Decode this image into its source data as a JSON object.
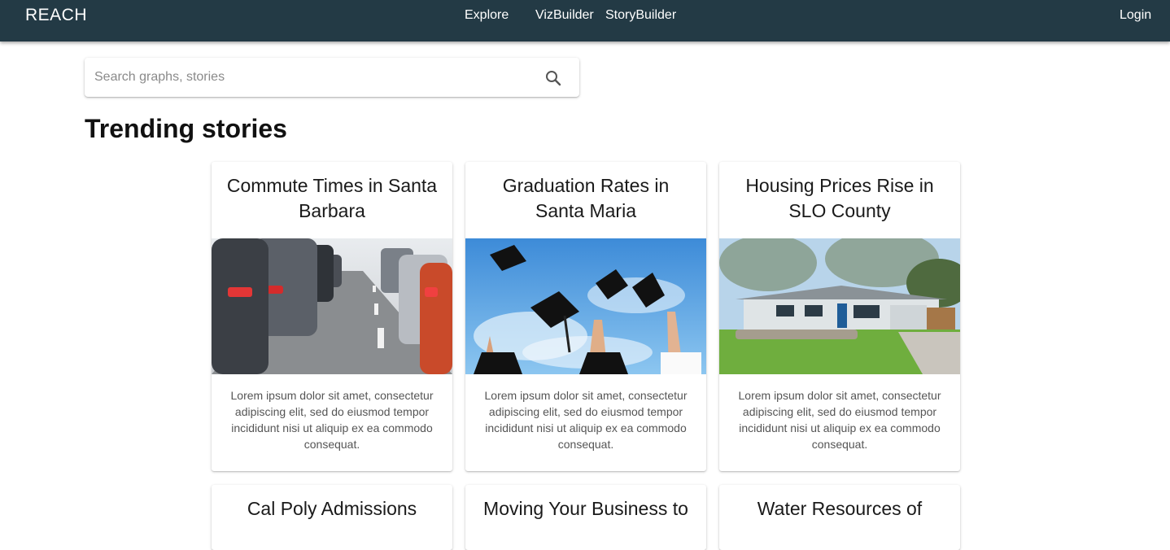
{
  "header": {
    "brand": "REACH",
    "nav": [
      "Explore",
      "VizBuilder",
      "StoryBuilder"
    ],
    "login": "Login",
    "bg_color": "#233a45"
  },
  "search": {
    "placeholder": "Search graphs, stories",
    "value": "",
    "icon": "search-icon"
  },
  "section_title": "Trending stories",
  "cards": [
    {
      "title": "Commute Times in Santa Barbara",
      "image": "traffic-photo",
      "body": "Lorem ipsum dolor sit amet, consectetur adipiscing elit, sed do eiusmod tempor incididunt nisi ut aliquip ex ea commodo consequat."
    },
    {
      "title": "Graduation Rates in Santa Maria",
      "image": "graduation-caps-photo",
      "body": "Lorem ipsum dolor sit amet, consectetur adipiscing elit, sed do eiusmod tempor incididunt nisi ut aliquip ex ea commodo consequat."
    },
    {
      "title": "Housing Prices Rise in SLO County",
      "image": "house-photo",
      "body": "Lorem ipsum dolor sit amet, consectetur adipiscing elit, sed do eiusmod tempor incididunt nisi ut aliquip ex ea commodo consequat."
    },
    {
      "title": "Cal Poly Admissions",
      "image": "",
      "body": ""
    },
    {
      "title": "Moving Your Business to",
      "image": "",
      "body": ""
    },
    {
      "title": "Water Resources of",
      "image": "",
      "body": ""
    }
  ]
}
